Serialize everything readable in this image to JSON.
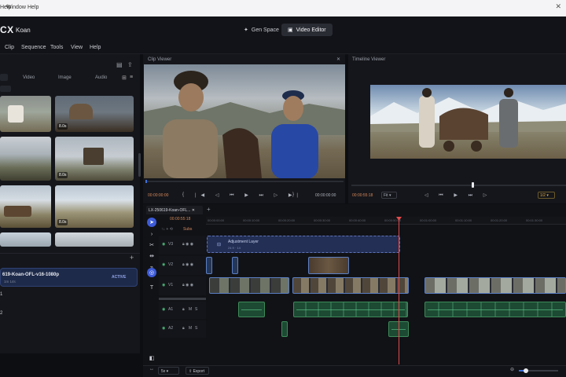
{
  "os_menu": {
    "items": [
      "Help",
      "Window",
      "Help"
    ]
  },
  "app": {
    "logo": "CX",
    "name": "Koan"
  },
  "modes": {
    "gen_space": "Gen Space",
    "video_editor": "Video Editor"
  },
  "menu": {
    "items": [
      "Clip",
      "Sequence",
      "Tools",
      "View",
      "Help"
    ]
  },
  "media": {
    "tabs": [
      "Video",
      "Image",
      "Audio"
    ],
    "thumbs": [
      {
        "dur": ""
      },
      {
        "dur": "8.0s"
      },
      {
        "dur": ""
      },
      {
        "dur": "8.0s"
      },
      {
        "dur": ""
      },
      {
        "dur": "8.0s"
      },
      {
        "dur": ""
      },
      {
        "dur": ""
      }
    ],
    "sequences": [
      {
        "name": "619-Koan-OFL-v16-1080p",
        "sub": "1m 14s",
        "badge": "ACTIVE"
      },
      {
        "name": "1",
        "sub": "",
        "badge": ""
      },
      {
        "name": "2",
        "sub": "",
        "badge": ""
      }
    ]
  },
  "clip_viewer": {
    "title": "Clip Viewer",
    "tc_left": "00:00:00:00",
    "tc_right": "00:00:00:00"
  },
  "timeline_viewer": {
    "title": "Timeline Viewer",
    "tc": "00:00:55:18",
    "fit": "Fit",
    "ratio": "1/2"
  },
  "timeline": {
    "tab": "LX-250619-Koan-OFL...",
    "current_tc": "00:00:55:18",
    "ruler": [
      "00:00:00:00",
      "00:00:10:00",
      "00:00:20:00",
      "00:00:30:00",
      "00:00:40:00",
      "00:00:50:00",
      "00:01:00:00",
      "00:01:10:00",
      "00:01:20:00",
      "00:01:30:00"
    ],
    "adjustment": {
      "label": "Adjustment Layer",
      "sub": "24.9 · 14"
    },
    "tracks": [
      "V3",
      "V2",
      "V1",
      "A1",
      "A2"
    ],
    "track_meta": [
      "M",
      "S"
    ],
    "subs": "Subs"
  },
  "bottom": {
    "speed": "5x",
    "export": "Export"
  },
  "colors": {
    "accent": "#3d5bd9",
    "playhead": "#e24b4b",
    "active_seq": "#1e2a4a"
  }
}
